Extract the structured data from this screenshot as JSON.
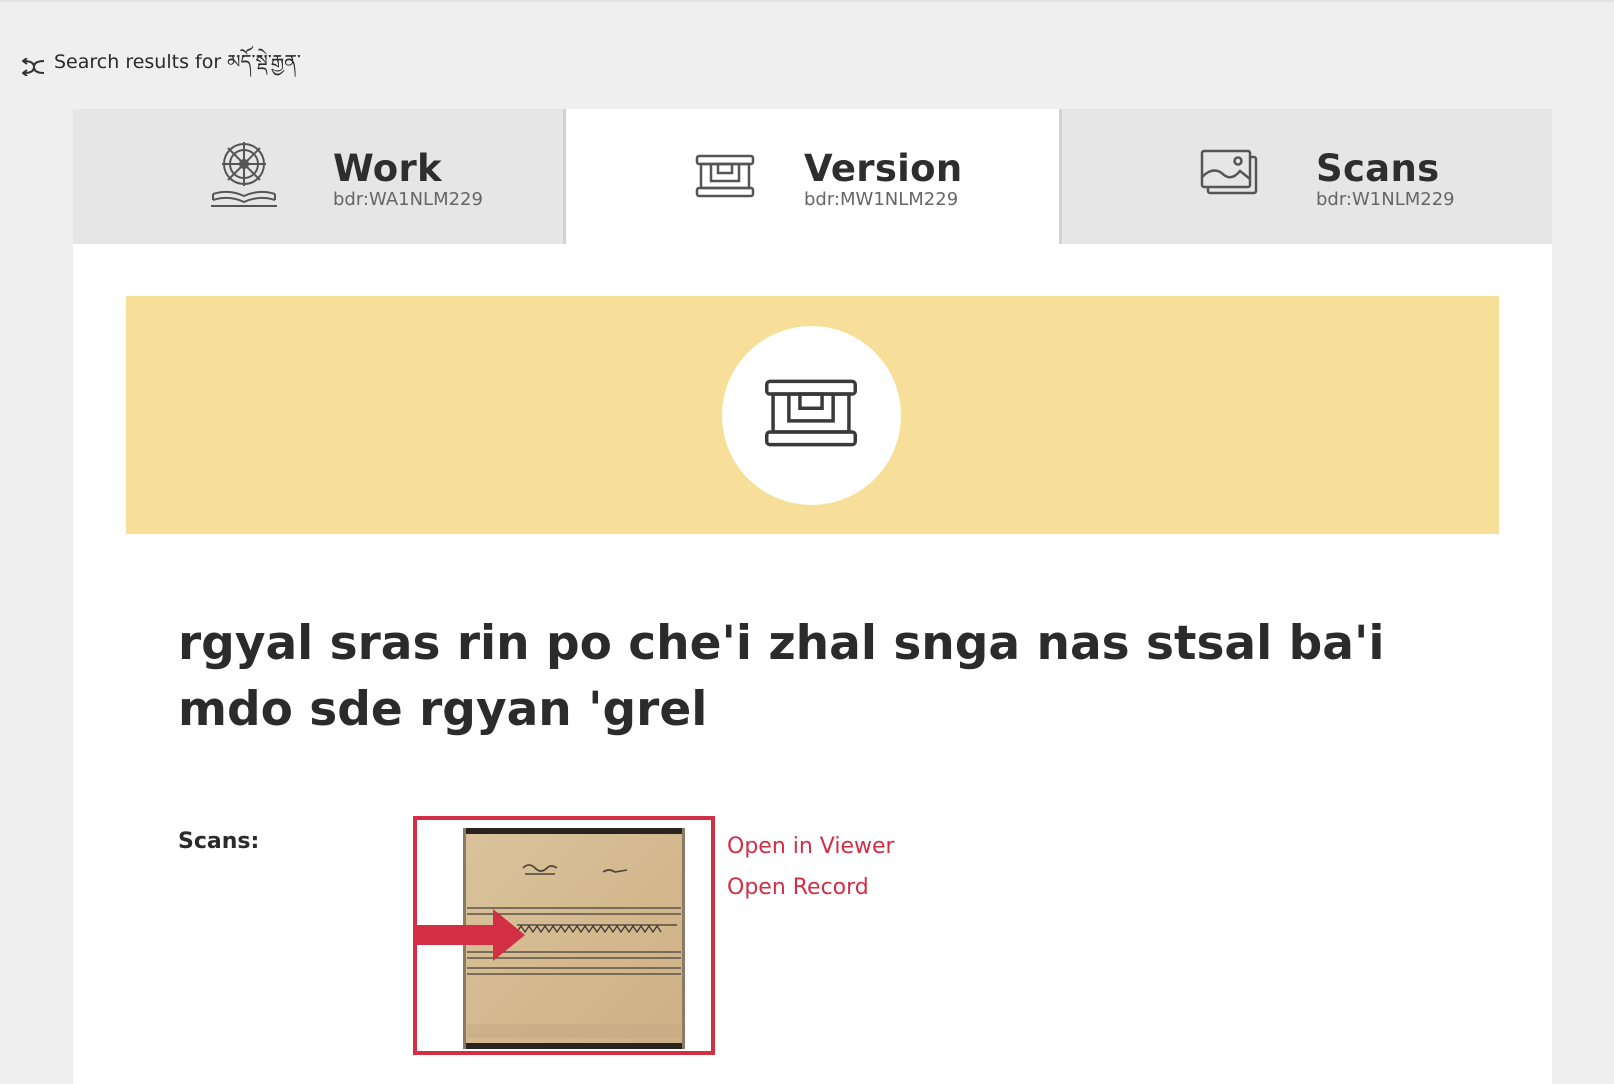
{
  "nav": {
    "back_label": "Search results for མདོ་སྡེ་རྒྱན་"
  },
  "tabs": [
    {
      "title": "Work",
      "id": "bdr:WA1NLM229",
      "icon": "dharma-wheel-book-icon",
      "active": false
    },
    {
      "title": "Version",
      "id": "bdr:MW1NLM229",
      "icon": "pecha-version-icon",
      "active": true
    },
    {
      "title": "Scans",
      "id": "bdr:W1NLM229",
      "icon": "images-icon",
      "active": false
    }
  ],
  "banner": {
    "color": "#f7df99",
    "icon": "pecha-version-icon"
  },
  "title": "rgyal sras rin po che'i zhal snga nas stsal ba'i mdo sde rgyan 'grel",
  "scans": {
    "label": "Scans:",
    "open_viewer": "Open in Viewer",
    "open_record": "Open Record",
    "highlight_color": "#d22f45"
  }
}
